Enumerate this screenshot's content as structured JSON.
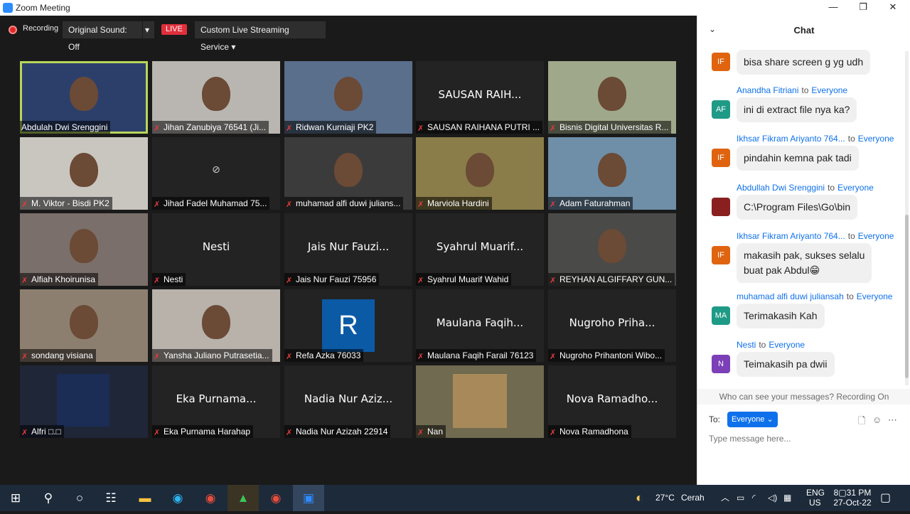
{
  "window": {
    "title": "Zoom Meeting",
    "controls": [
      "—",
      "❐",
      "✕"
    ]
  },
  "toolbar": {
    "recording_label": "Recording",
    "original_sound": "Original Sound: Off",
    "dropdown_arrow": "▾",
    "live_label": "LIVE",
    "streaming": "Custom Live Streaming Service ▾"
  },
  "participants": [
    {
      "name": "Abdulah Dwi Srenggini",
      "muted": false,
      "video": true,
      "active": true
    },
    {
      "name": "Jihan Zanubiya 76541 (Ji...",
      "muted": true,
      "video": true
    },
    {
      "name": "Ridwan Kurniaji PK2",
      "muted": true,
      "video": true
    },
    {
      "name": "SAUSAN RAIHANA PUTRI ...",
      "muted": true,
      "video": false,
      "display": "SAUSAN RAIH..."
    },
    {
      "name": "Bisnis Digital Universitas R...",
      "muted": true,
      "video": true
    },
    {
      "name": "M. Viktor - Bisdi PK2",
      "muted": true,
      "video": true
    },
    {
      "name": "Jihad Fadel Muhamad 75...",
      "muted": true,
      "video": false,
      "icon": "video-off-icon"
    },
    {
      "name": "muhamad alfi duwi julians...",
      "muted": true,
      "video": true
    },
    {
      "name": "Marviola Hardini",
      "muted": true,
      "video": true
    },
    {
      "name": "Adam Faturahman",
      "muted": true,
      "video": true
    },
    {
      "name": "Alfiah Khoirunisa",
      "muted": true,
      "video": true
    },
    {
      "name": "Nesti",
      "muted": true,
      "video": false,
      "display": "Nesti"
    },
    {
      "name": "Jais Nur Fauzi 75956",
      "muted": true,
      "video": false,
      "display": "Jais Nur Fauzi..."
    },
    {
      "name": "Syahrul Muarif Wahid",
      "muted": true,
      "video": false,
      "display": "Syahrul Muarif..."
    },
    {
      "name": "REYHAN ALGIFFARY GUN...",
      "muted": true,
      "video": true
    },
    {
      "name": "sondang visiana",
      "muted": true,
      "video": true
    },
    {
      "name": "Yansha Juliano Putrasetia...",
      "muted": true,
      "video": true
    },
    {
      "name": "Refa Azka 76033",
      "muted": true,
      "video": false,
      "avatar_letter": "R"
    },
    {
      "name": "Maulana Faqih Farail 76123",
      "muted": true,
      "video": false,
      "display": "Maulana Faqih..."
    },
    {
      "name": "Nugroho Prihantoni Wibo...",
      "muted": true,
      "video": false,
      "display": "Nugroho Priha..."
    },
    {
      "name": "Alfri □.□",
      "muted": true,
      "video": true
    },
    {
      "name": "Eka Purnama Harahap",
      "muted": true,
      "video": false,
      "display": "Eka Purnama..."
    },
    {
      "name": "Nadia Nur Azizah 22914",
      "muted": true,
      "video": false,
      "display": "Nadia Nur Aziz..."
    },
    {
      "name": "Nan",
      "muted": true,
      "video": true
    },
    {
      "name": "Nova Ramadhona",
      "muted": true,
      "video": false,
      "display": "Nova Ramadho..."
    }
  ],
  "chat": {
    "title": "Chat",
    "collapse_icon": "chevron-down-icon",
    "to_word": "to",
    "messages": [
      {
        "sender": "",
        "to": "",
        "avatar": "IF",
        "color": "#e0640f",
        "text": "bisa share screen g yg udh"
      },
      {
        "sender": "Anandha Fitriani",
        "to": "Everyone",
        "avatar": "AF",
        "color": "#1f9a87",
        "text": "ini di extract file nya ka?"
      },
      {
        "sender": "Ikhsar Fikram Ariyanto 764...",
        "to": "Everyone",
        "avatar": "IF",
        "color": "#e0640f",
        "text": "pindahin kemna pak tadi"
      },
      {
        "sender": "Abdullah Dwi Srenggini",
        "to": "Everyone",
        "avatar": "",
        "color": "#8a1f1f",
        "text": "C:\\Program Files\\Go\\bin"
      },
      {
        "sender": "Ikhsar Fikram Ariyanto 764...",
        "to": "Everyone",
        "avatar": "IF",
        "color": "#e0640f",
        "text": "makasih pak, sukses selalu",
        "text2": "buat pak Abdul😁"
      },
      {
        "sender": "muhamad alfi duwi juliansah",
        "to": "Everyone",
        "avatar": "MA",
        "color": "#1f9a87",
        "text": "Terimakasih Kah"
      },
      {
        "sender": "Nesti",
        "to": "Everyone",
        "avatar": "N",
        "color": "#7b3fb7",
        "text": "Teimakasih pa dwii"
      }
    ],
    "notice": "Who can see your messages? Recording On",
    "to_label": "To:",
    "recipient": "Everyone ⌄",
    "input_placeholder": "Type message here..."
  },
  "taskbar": {
    "weather_temp": "27°C",
    "weather_desc": "Cerah",
    "lang": "ENG",
    "region": "US",
    "time": "8▢31 PM",
    "date": "27-Oct-22"
  }
}
